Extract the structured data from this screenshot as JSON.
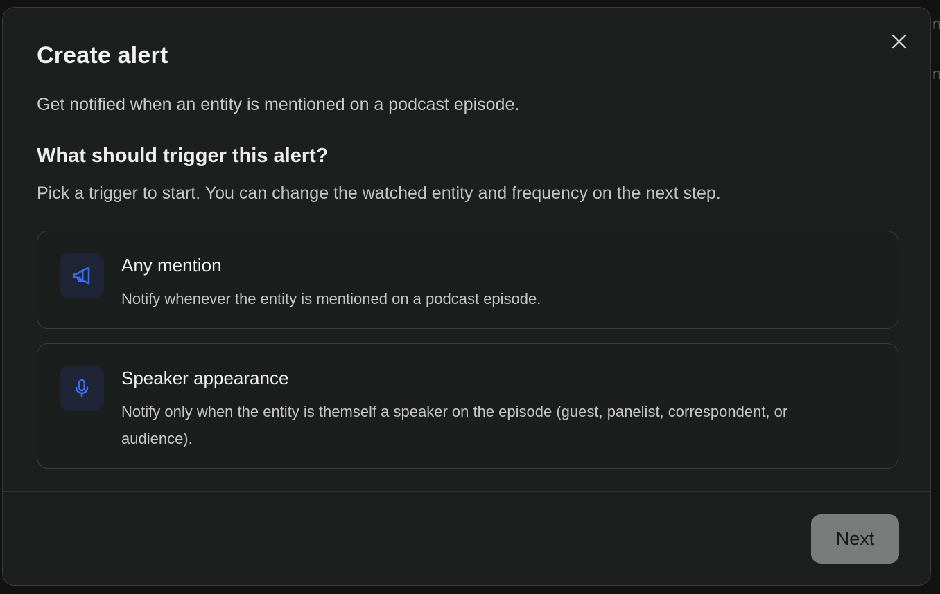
{
  "background": {
    "fragment_right_1": "n",
    "fragment_right_2": "n"
  },
  "dialog": {
    "title": "Create alert",
    "subtitle": "Get notified when an entity is mentioned on a podcast episode.",
    "section_heading": "What should trigger this alert?",
    "section_description": "Pick a trigger to start. You can change the watched entity and frequency on the next step.",
    "options": [
      {
        "icon": "megaphone-icon",
        "title": "Any mention",
        "description": "Notify whenever the entity is mentioned on a podcast episode."
      },
      {
        "icon": "microphone-icon",
        "title": "Speaker appearance",
        "description": "Notify only when the entity is themself a speaker on the episode (guest, panelist, correspondent, or audience)."
      }
    ],
    "next_label": "Next",
    "close_icon": "close-icon"
  },
  "colors": {
    "modal_bg": "#1d1e1e",
    "icon_accent": "#3b6ff0",
    "icon_tile_bg": "#1f2536",
    "next_button_bg": "#7a7c7b"
  }
}
